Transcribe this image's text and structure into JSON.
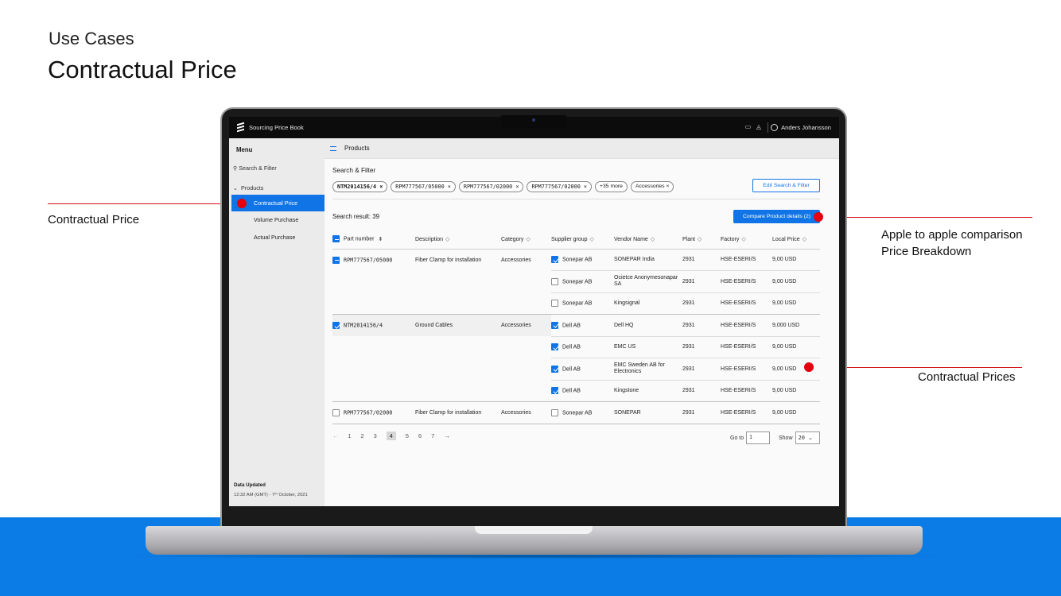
{
  "slide": {
    "subtitle": "Use Cases",
    "title": "Contractual Price"
  },
  "annotations": {
    "left_label": "Contractual Price",
    "right_top_line1": "Apple to apple comparison",
    "right_top_line2": "Price Breakdown",
    "right_bottom": "Contractual Prices",
    "dot_color": "#e3000f"
  },
  "app": {
    "title": "Sourcing Price Book",
    "user": "Anders Johansson",
    "icons": [
      "chat-icon",
      "bell-icon",
      "user-icon"
    ],
    "accent": "#1174e6"
  },
  "sidebar": {
    "menu": "Menu",
    "search": "Search & Filter",
    "products": "Products",
    "items": [
      "Contractual Price",
      "Volume Purchase",
      "Actual Purchase"
    ],
    "data_updated_label": "Data Updated",
    "data_updated_value": "12:32 AM (GMT) - 7ᵗʰ October, 2021"
  },
  "header": {
    "title": "Products"
  },
  "filter": {
    "title": "Search & Filter",
    "chips": [
      "NTM2014156/4",
      "RPM777567/05000",
      "RPM777567/02000",
      "RPM777567/02000",
      "+35 more",
      "Accessories"
    ],
    "edit_button": "Edit Search & Filter"
  },
  "results": {
    "label": "Search result: 39",
    "compare_button": "Compare Product details (2)"
  },
  "table": {
    "columns": [
      "Part number",
      "Description",
      "Category",
      "Supplier group",
      "Vendor Name",
      "Plant",
      "Factory",
      "Local Price"
    ],
    "rows": [
      {
        "part": "RPM777567/05000",
        "desc": "Fiber Clamp for installation",
        "cat": "Accessories",
        "supplier": "Sonepar AB",
        "sup_checked": true,
        "vendor": "SONEPAR India",
        "plant": "2931",
        "factory": "HSE-ESERI/S",
        "price": "9,00 USD"
      },
      {
        "supplier": "Sonepar AB",
        "sup_checked": false,
        "vendor": "Ocietce Anonymesonapar SA",
        "plant": "2931",
        "factory": "HSE-ESERI/S",
        "price": "9,00 USD"
      },
      {
        "supplier": "Sonepar AB",
        "sup_checked": false,
        "vendor": "Kingsignal",
        "plant": "2931",
        "factory": "HSE-ESERI/S",
        "price": "9,00 USD"
      },
      {
        "part": "NTM2014156/4",
        "desc": "Ground Cables",
        "cat": "Accessories",
        "supplier": "Dell AB",
        "sup_checked": true,
        "vendor": "Dell HQ",
        "plant": "2931",
        "factory": "HSE-ESERI/S",
        "price": "9,000 USD"
      },
      {
        "supplier": "Dell AB",
        "sup_checked": true,
        "vendor": "EMC US",
        "plant": "2931",
        "factory": "HSE-ESERI/S",
        "price": "9,00 USD"
      },
      {
        "supplier": "Dell AB",
        "sup_checked": true,
        "vendor": "EMC Sweden AB for Electronics",
        "plant": "2931",
        "factory": "HSE-ESERI/S",
        "price": "9,00 USD"
      },
      {
        "supplier": "Dell AB",
        "sup_checked": true,
        "vendor": "Kingstone",
        "plant": "2931",
        "factory": "HSE-ESERI/S",
        "price": "9,00 USD"
      },
      {
        "part": "RPM777567/02000",
        "desc": "Fiber Clamp for installation",
        "cat": "Accessories",
        "supplier": "Sonepar AB",
        "sup_checked": false,
        "vendor": "SONEPAR",
        "plant": "2931",
        "factory": "HSE-ESERI/S",
        "price": "9,00 USD"
      }
    ]
  },
  "pager": {
    "prev": "←",
    "pages": [
      "1",
      "2",
      "3",
      "4",
      "5",
      "6",
      "7"
    ],
    "current": "4",
    "next": "→",
    "goto_label": "Go to",
    "goto_value": "1",
    "show_label": "Show",
    "show_value": "20"
  }
}
